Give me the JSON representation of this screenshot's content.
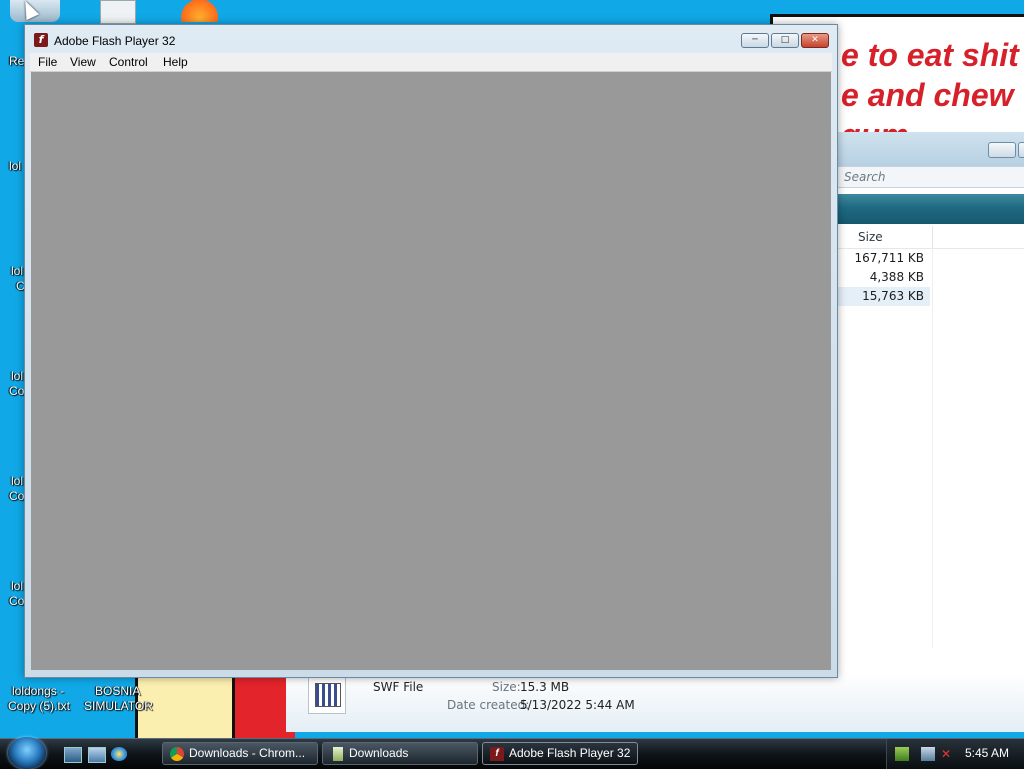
{
  "wallpaper": {
    "sign_lines": [
      "e to eat shit",
      "e and chew",
      "gum"
    ]
  },
  "desktop": {
    "icons": [
      {
        "label": "Re",
        "icon": "recycle-bin-icon"
      },
      {
        "label": "lol",
        "icon": "text-file-icon"
      },
      {
        "label": "lol",
        "icon": "text-file-icon"
      },
      {
        "label": "C",
        "icon": "text-file-icon"
      },
      {
        "label": "lol",
        "icon": "text-file-icon"
      },
      {
        "label": "Co",
        "icon": "text-file-icon"
      },
      {
        "label": "lol",
        "icon": "text-file-icon"
      },
      {
        "label": "Co",
        "icon": "text-file-icon"
      },
      {
        "label": "lol",
        "icon": "text-file-icon"
      },
      {
        "label": "Co",
        "icon": "text-file-icon"
      }
    ],
    "bottom_icons": [
      {
        "line1": "loldongs -",
        "line2": "Copy (5).txt"
      },
      {
        "line1": "BOSNIA",
        "line2": "SIMULATOR"
      }
    ]
  },
  "explorer": {
    "search_placeholder": "Search",
    "column_size": "Size",
    "rows": [
      "167,711 KB",
      "4,388 KB",
      "15,763 KB"
    ],
    "details": {
      "type": "SWF File",
      "size_label": "Size:",
      "size_value": "15.3 MB",
      "created_label": "Date created:",
      "created_value": "5/13/2022 5:44 AM"
    }
  },
  "flash_window": {
    "title": "Adobe Flash Player 32",
    "logo_glyph": "f",
    "menu": [
      "File",
      "View",
      "Control",
      "Help"
    ],
    "stage_color": "#999999"
  },
  "taskbar": {
    "tasks": [
      {
        "label": "Downloads - Chrom...",
        "icon": "chrome-icon"
      },
      {
        "label": "Downloads",
        "icon": "folder-icon"
      },
      {
        "label": "Adobe Flash Player 32",
        "icon": "flash-icon"
      }
    ],
    "clock": "5:45 AM"
  }
}
